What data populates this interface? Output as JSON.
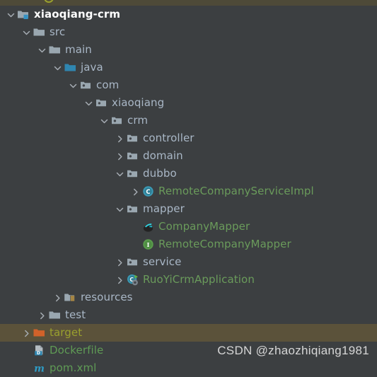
{
  "window": {
    "background_color": "#3c3f41",
    "selection_color": "#5b523a",
    "default_text_color": "#a9b7c6",
    "green_text_color": "#6a9b5b",
    "olive_text_color": "#9aa02e"
  },
  "watermark": {
    "text": "CSDN @zhaozhiqiang1981"
  },
  "tree": {
    "name": "project-tool-window",
    "rows": [
      {
        "label": "xiaoqiang-crm",
        "depth": 0,
        "twisty": "expanded",
        "icon": "module-folder-icon",
        "style": "root"
      },
      {
        "label": "src",
        "depth": 1,
        "twisty": "expanded",
        "icon": "folder-icon",
        "style": "default"
      },
      {
        "label": "main",
        "depth": 2,
        "twisty": "expanded",
        "icon": "folder-icon",
        "style": "default"
      },
      {
        "label": "java",
        "depth": 3,
        "twisty": "expanded",
        "icon": "source-root-folder-icon",
        "style": "default"
      },
      {
        "label": "com",
        "depth": 4,
        "twisty": "expanded",
        "icon": "package-folder-icon",
        "style": "default"
      },
      {
        "label": "xiaoqiang",
        "depth": 5,
        "twisty": "expanded",
        "icon": "package-folder-icon",
        "style": "default"
      },
      {
        "label": "crm",
        "depth": 6,
        "twisty": "expanded",
        "icon": "package-folder-icon",
        "style": "default"
      },
      {
        "label": "controller",
        "depth": 7,
        "twisty": "collapsed",
        "icon": "package-folder-icon",
        "style": "default"
      },
      {
        "label": "domain",
        "depth": 7,
        "twisty": "collapsed",
        "icon": "package-folder-icon",
        "style": "default"
      },
      {
        "label": "dubbo",
        "depth": 7,
        "twisty": "expanded",
        "icon": "package-folder-icon",
        "style": "default"
      },
      {
        "label": "RemoteCompanyServiceImpl",
        "depth": 8,
        "twisty": "collapsed",
        "icon": "java-class-icon",
        "style": "green"
      },
      {
        "label": "mapper",
        "depth": 7,
        "twisty": "expanded",
        "icon": "package-folder-icon",
        "style": "default"
      },
      {
        "label": "CompanyMapper",
        "depth": 8,
        "twisty": "none",
        "icon": "mybatis-mapper-icon",
        "style": "green"
      },
      {
        "label": "RemoteCompanyMapper",
        "depth": 8,
        "twisty": "none",
        "icon": "java-interface-icon",
        "style": "green"
      },
      {
        "label": "service",
        "depth": 7,
        "twisty": "collapsed",
        "icon": "package-folder-icon",
        "style": "default"
      },
      {
        "label": "RuoYiCrmApplication",
        "depth": 7,
        "twisty": "collapsed",
        "icon": "spring-boot-run-class-icon",
        "style": "green"
      },
      {
        "label": "resources",
        "depth": 3,
        "twisty": "collapsed",
        "icon": "resources-root-folder-icon",
        "style": "default"
      },
      {
        "label": "test",
        "depth": 2,
        "twisty": "collapsed",
        "icon": "folder-icon",
        "style": "default"
      },
      {
        "label": "target",
        "depth": 1,
        "twisty": "collapsed",
        "icon": "excluded-folder-icon",
        "style": "olive",
        "selected": true
      },
      {
        "label": "Dockerfile",
        "depth": 1,
        "twisty": "none",
        "icon": "dockerfile-icon",
        "style": "dockergreen"
      },
      {
        "label": "pom.xml",
        "depth": 1,
        "twisty": "none",
        "icon": "maven-pom-icon",
        "style": "dockergreen"
      }
    ]
  }
}
